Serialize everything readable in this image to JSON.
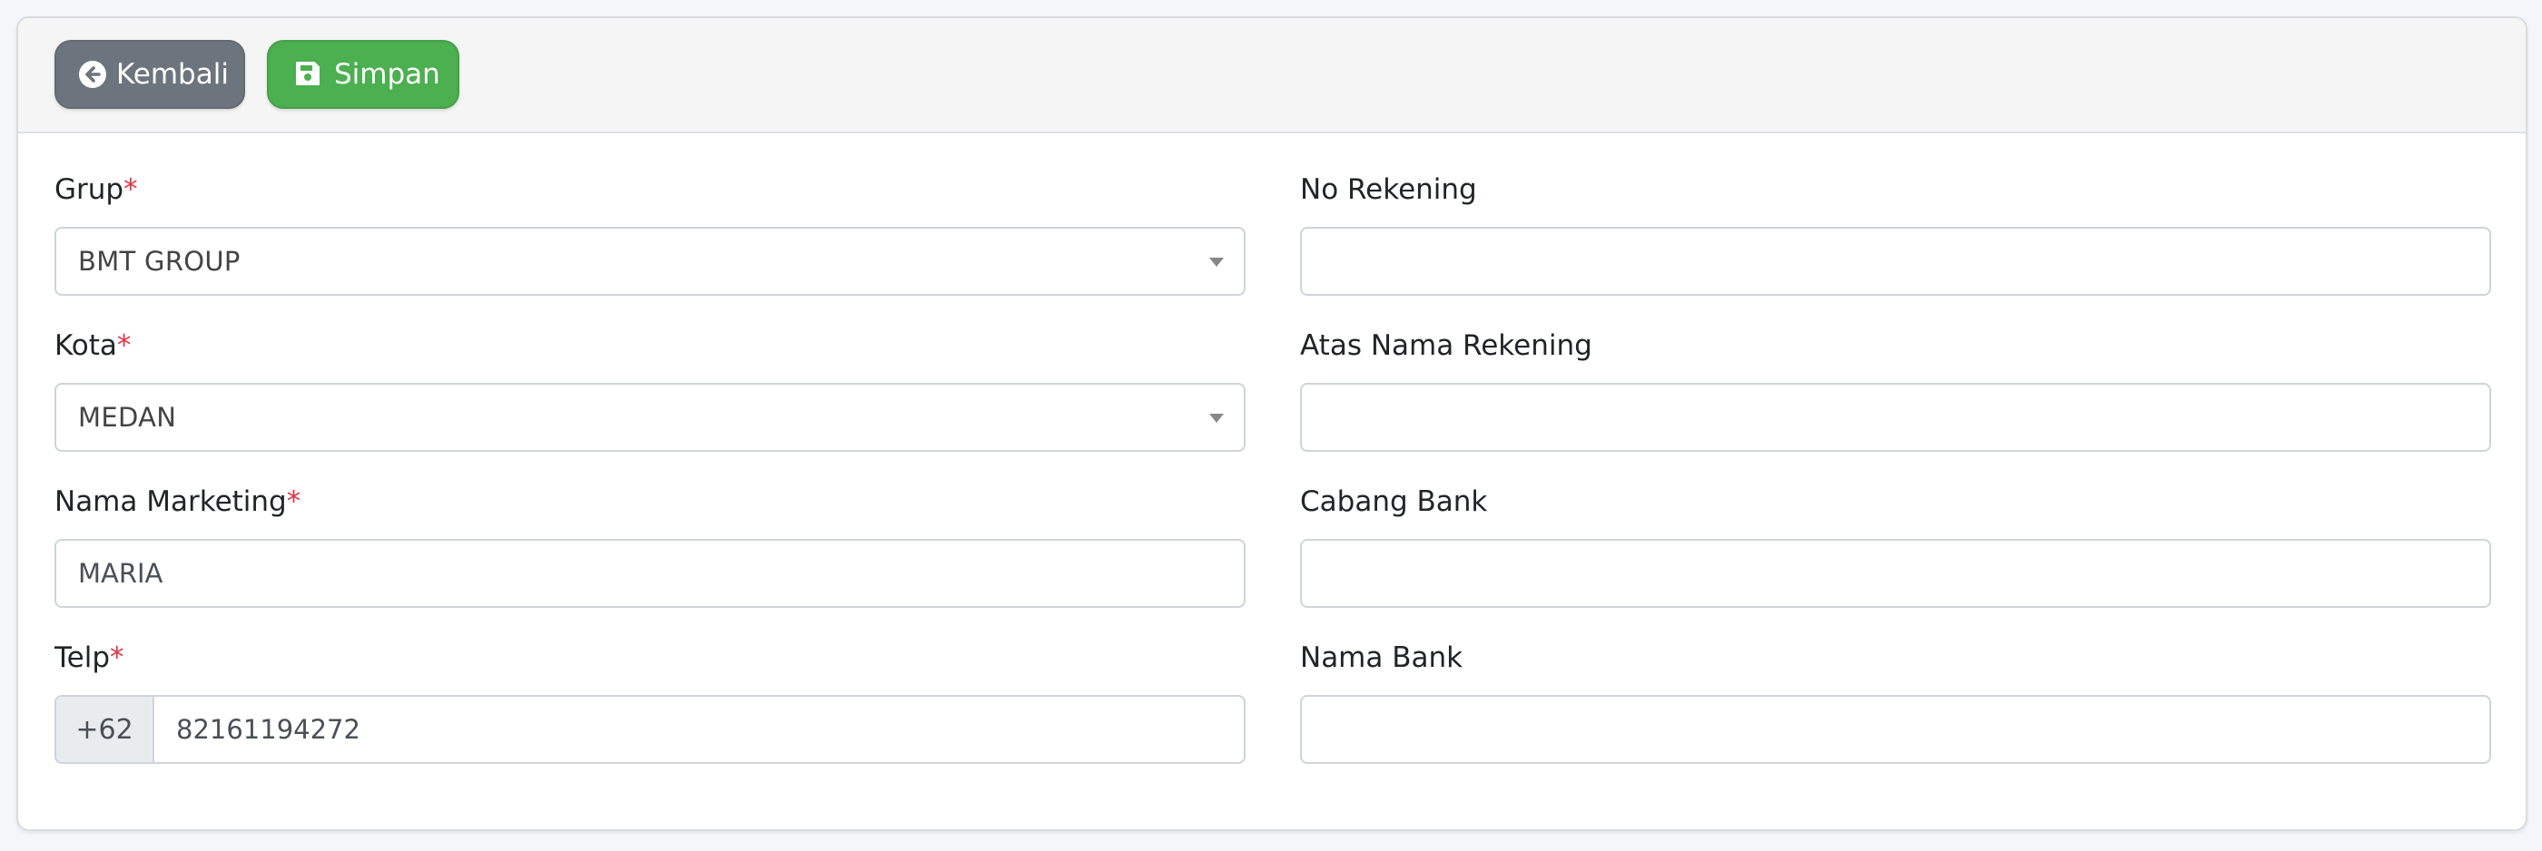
{
  "toolbar": {
    "back_label": "Kembali",
    "save_label": "Simpan"
  },
  "form": {
    "grup": {
      "label": "Grup",
      "required": "*",
      "value": "BMT GROUP"
    },
    "kota": {
      "label": "Kota",
      "required": "*",
      "value": "MEDAN"
    },
    "nama_marketing": {
      "label": "Nama Marketing",
      "required": "*",
      "value": "MARIA"
    },
    "telp": {
      "label": "Telp",
      "required": "*",
      "prefix": "+62",
      "value": "82161194272"
    },
    "no_rekening": {
      "label": "No Rekening",
      "value": ""
    },
    "atas_nama_rekening": {
      "label": "Atas Nama Rekening",
      "value": ""
    },
    "cabang_bank": {
      "label": "Cabang Bank",
      "value": ""
    },
    "nama_bank": {
      "label": "Nama Bank",
      "value": ""
    }
  },
  "icons": {
    "back": "arrow-circle-left-icon",
    "save": "floppy-disk-icon"
  },
  "colors": {
    "back_button": "#6c757d",
    "save_button": "#4caf50",
    "required": "#dc3545"
  }
}
